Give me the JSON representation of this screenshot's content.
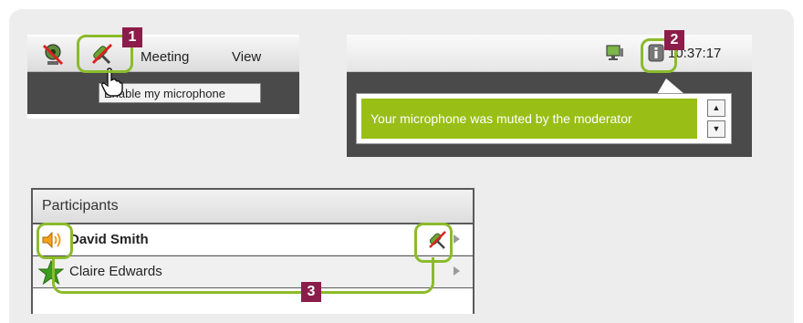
{
  "shot1": {
    "menu": [
      "Meeting",
      "View"
    ],
    "tooltip": "Enable my microphone"
  },
  "shot2": {
    "clock": "10:37:17",
    "notification": "Your microphone was muted by the moderator",
    "scroll_up": "▲",
    "scroll_down": "▼"
  },
  "participants": {
    "title": "Participants",
    "rows": [
      {
        "name": "David Smith"
      },
      {
        "name": "Claire Edwards"
      }
    ]
  },
  "callouts": [
    "1",
    "2",
    "3"
  ],
  "colors": {
    "highlight": "#8bbb2c",
    "badge": "#8c1d4a",
    "notification_bg": "#99bf16",
    "panel_bg": "#ededed"
  },
  "icons": [
    "webcam-muted-icon",
    "microphone-muted-icon",
    "hand-cursor-icon",
    "monitor-icon",
    "info-icon",
    "speaker-icon",
    "moderator-star-icon"
  ]
}
